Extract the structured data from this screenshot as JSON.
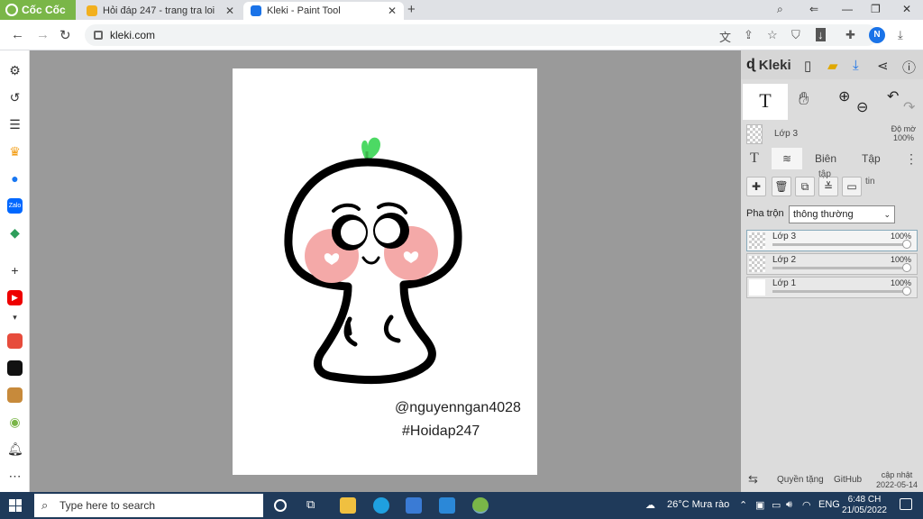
{
  "browser": {
    "brand": "Cốc Cốc",
    "tabs": [
      {
        "label": "Hỏi đáp 247 - trang tra loi",
        "active": false
      },
      {
        "label": "Kleki - Paint Tool",
        "active": true
      }
    ],
    "url": "kleki.com",
    "profile_initial": "N"
  },
  "canvas": {
    "signature_handle": "@nguyenngan4028",
    "signature_tag": "#Hoidap247"
  },
  "kleki": {
    "app_name": "Kleki",
    "current_layer": {
      "name": "Lớp 3",
      "opacity_label": "Độ mờ",
      "opacity": "100%"
    },
    "subtabs": [
      "Biên",
      "Tập"
    ],
    "action_notes": {
      "tap": "tập",
      "tin": "tin"
    },
    "blend_label": "Pha trộn",
    "blend_value": "thông thường",
    "layers": [
      {
        "name": "Lớp 3",
        "opacity": "100%",
        "opacity_value": 1.0,
        "selected": true
      },
      {
        "name": "Lớp 2",
        "opacity": "100%",
        "opacity_value": 1.0,
        "selected": false
      },
      {
        "name": "Lớp 1",
        "opacity": "100%",
        "opacity_value": 1.0,
        "selected": false
      }
    ],
    "footer": {
      "license": "Quyền tặng",
      "github": "GitHub",
      "update_label": "cập nhật",
      "update_date": "2022-05-14"
    }
  },
  "taskbar": {
    "search_placeholder": "Type here to search",
    "weather": "26°C  Mưa rào",
    "lang": "ENG",
    "time": "6:48 CH",
    "date": "21/05/2022"
  },
  "colors": {
    "brand": "#7ab648",
    "accent_green": "#4cd964",
    "blush": "#f4a9a8"
  }
}
